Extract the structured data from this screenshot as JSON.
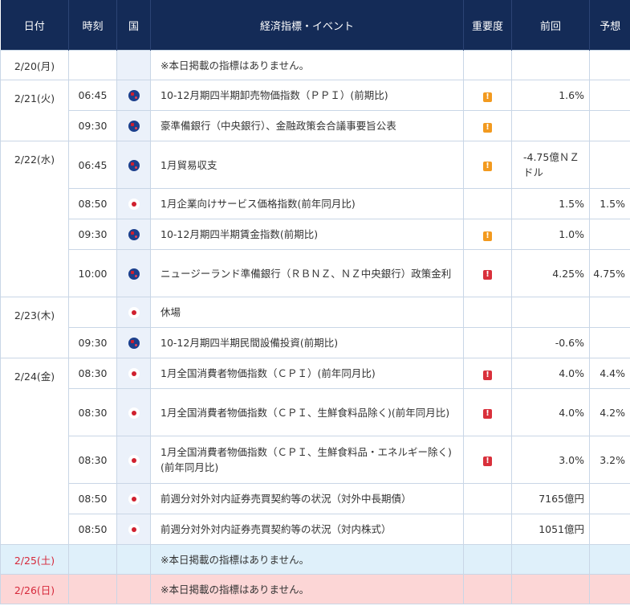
{
  "headers": {
    "date": "日付",
    "time": "時刻",
    "country": "国",
    "event": "経済指標・イベント",
    "importance": "重要度",
    "previous": "前回",
    "forecast": "予想"
  },
  "days": {
    "d0220": "2/20(月)",
    "d0221": "2/21(火)",
    "d0222": "2/22(水)",
    "d0223": "2/23(木)",
    "d0224": "2/24(金)",
    "d0225": "2/25(土)",
    "d0226": "2/26(日)"
  },
  "no_events_text": "※本日掲載の指標はありません。",
  "icons": {
    "nz": "new-zealand-flag-icon",
    "jp": "japan-flag-icon",
    "importance_medium": "orange-exclamation-icon",
    "importance_high": "red-exclamation-icon"
  },
  "badge_symbol": "!",
  "colors": {
    "header_bg": "#142b57",
    "importance_medium": "#f29a1f",
    "importance_high": "#d9303b",
    "saturday_bg": "#dff0fa",
    "sunday_bg": "#fcd6d6",
    "weekend_date_text": "#d6283a"
  },
  "events": [
    {
      "time": "06:45",
      "country": "nz",
      "name": "10-12月期四半期卸売物価指数（ＰＰＩ）(前期比)",
      "importance": "medium",
      "previous": "1.6%",
      "forecast": ""
    },
    {
      "time": "09:30",
      "country": "nz",
      "name": "豪準備銀行（中央銀行）、金融政策会合議事要旨公表",
      "importance": "medium",
      "previous": "",
      "forecast": ""
    },
    {
      "time": "06:45",
      "country": "nz",
      "name": "1月貿易収支",
      "importance": "medium",
      "previous": "-4.75億ＮＺドル",
      "forecast": ""
    },
    {
      "time": "08:50",
      "country": "jp",
      "name": "1月企業向けサービス価格指数(前年同月比)",
      "importance": "",
      "previous": "1.5%",
      "forecast": "1.5%"
    },
    {
      "time": "09:30",
      "country": "nz",
      "name": "10-12月期四半期賃金指数(前期比)",
      "importance": "medium",
      "previous": "1.0%",
      "forecast": ""
    },
    {
      "time": "10:00",
      "country": "nz",
      "name": "ニュージーランド準備銀行（ＲＢＮＺ、ＮＺ中央銀行）政策金利",
      "importance": "high",
      "previous": "4.25%",
      "forecast": "4.75%"
    },
    {
      "time": "",
      "country": "jp",
      "name": "休場",
      "importance": "",
      "previous": "",
      "forecast": ""
    },
    {
      "time": "09:30",
      "country": "nz",
      "name": "10-12月期四半期民間設備投資(前期比)",
      "importance": "",
      "previous": "-0.6%",
      "forecast": ""
    },
    {
      "time": "08:30",
      "country": "jp",
      "name": "1月全国消費者物価指数（ＣＰＩ）(前年同月比)",
      "importance": "high",
      "previous": "4.0%",
      "forecast": "4.4%"
    },
    {
      "time": "08:30",
      "country": "jp",
      "name": "1月全国消費者物価指数（ＣＰＩ、生鮮食料品除く)(前年同月比)",
      "importance": "high",
      "previous": "4.0%",
      "forecast": "4.2%"
    },
    {
      "time": "08:30",
      "country": "jp",
      "name": "1月全国消費者物価指数（ＣＰＩ、生鮮食料品・エネルギー除く)(前年同月比)",
      "importance": "high",
      "previous": "3.0%",
      "forecast": "3.2%"
    },
    {
      "time": "08:50",
      "country": "jp",
      "name": "前週分対外対内証券売買契約等の状況（対外中長期債）",
      "importance": "",
      "previous": "7165億円",
      "forecast": ""
    },
    {
      "time": "08:50",
      "country": "jp",
      "name": "前週分対外対内証券売買契約等の状況（対内株式）",
      "importance": "",
      "previous": "1051億円",
      "forecast": ""
    }
  ]
}
